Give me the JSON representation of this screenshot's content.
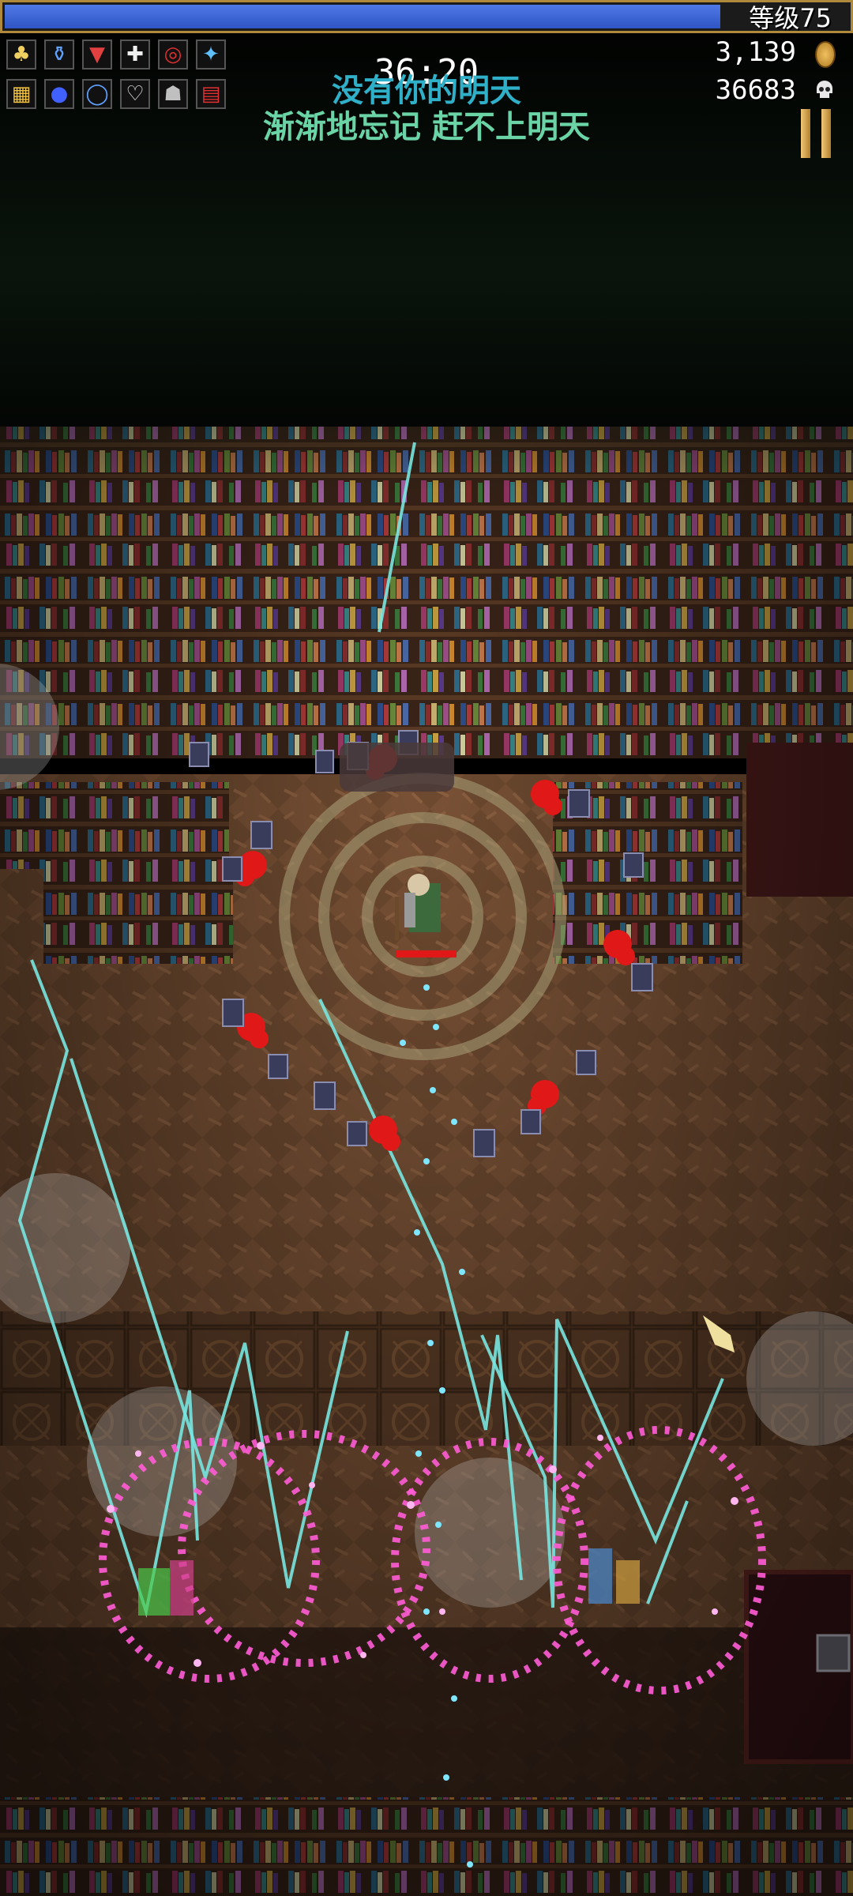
{
  "hud": {
    "level_label": "等级75",
    "xp_progress": 0.845,
    "timer": "36:20",
    "gold": "3,139",
    "kills": "36683",
    "weapon_icons": [
      "clover-icon",
      "potion-icon",
      "armor-icon",
      "cross-icon",
      "ring-icon",
      "wand-icon"
    ],
    "passive_icons": [
      "spellbinder-icon",
      "orb-icon",
      "halo-icon",
      "heart-icon",
      "skull-mask-icon",
      "tome-icon"
    ]
  },
  "lyrics": {
    "line1": "没有你的明天",
    "line2": "渐渐地忘记 赶不上明天"
  },
  "colors": {
    "xp_fill": "#3a62d8",
    "hud_border": "#b08a3c",
    "lyric1": "#2fb0c8",
    "lyric2": "#6bd4a6",
    "magic_pink": "#ff5cd6",
    "lightning": "#78e6e0",
    "enemy_red": "#e01818"
  }
}
